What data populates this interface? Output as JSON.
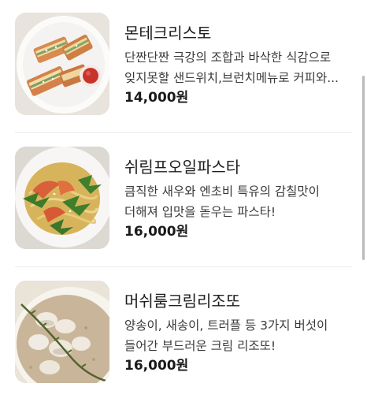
{
  "menu": {
    "items": [
      {
        "name": "몬테크리스토",
        "description": "단짠단짠 극강의 조합과 바삭한 식감으로 잊지못할 샌드위치,브런치메뉴로 커피와...",
        "price": "14,000원",
        "image_icon": "sandwich-plate-photo"
      },
      {
        "name": "쉬림프오일파스타",
        "description": "큼직한 새우와 엔초비 특유의 감칠맛이 더해져 입맛을 돋우는 파스타!",
        "price": "16,000원",
        "image_icon": "shrimp-pasta-photo"
      },
      {
        "name": "머쉬룸크림리조또",
        "description": "양송이, 새송이, 트러플 등 3가지 버섯이 들어간 부드러운 크림 리조또!",
        "price": "16,000원",
        "image_icon": "mushroom-risotto-photo"
      }
    ]
  },
  "colors": {
    "text_primary": "#1e1e1e",
    "text_secondary": "#3a3a3a",
    "divider": "#ececec",
    "scrollbar": "#b9b9b9"
  }
}
